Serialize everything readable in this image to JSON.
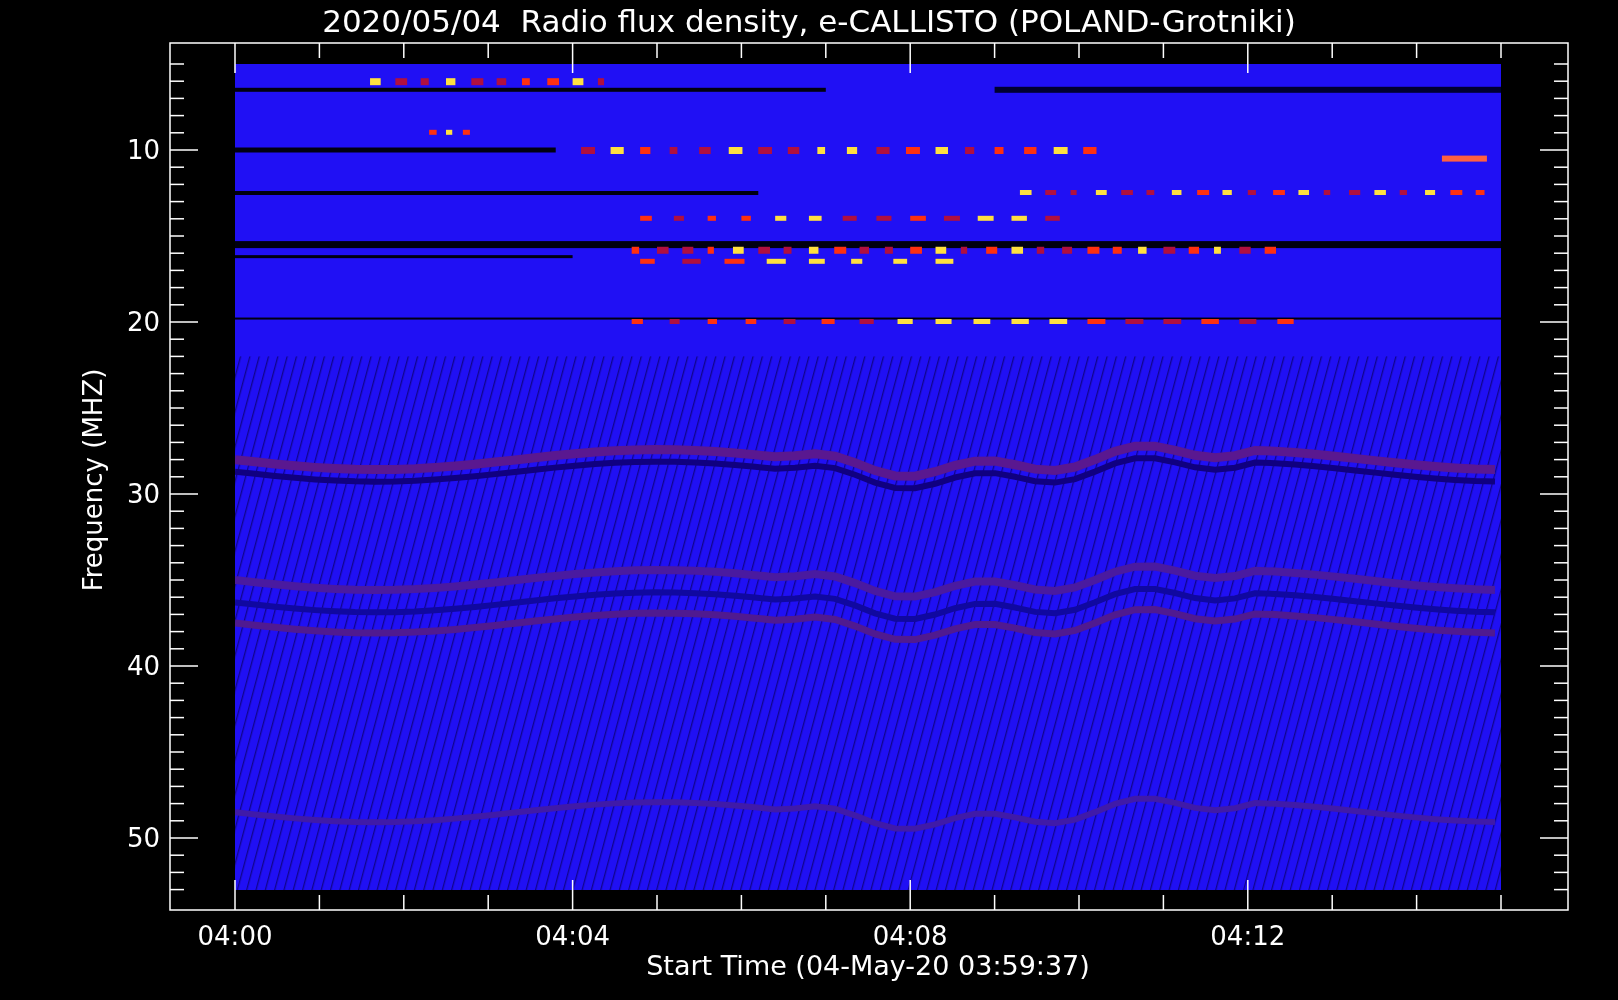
{
  "title": "2020/05/04  Radio flux density, e-CALLISTO (POLAND-Grotniki)",
  "y_axis": {
    "label": "Frequency (MHZ)",
    "ticks": [
      "10",
      "20",
      "30",
      "40",
      "50"
    ]
  },
  "x_axis": {
    "label": "Start Time (04-May-20 03:59:37)",
    "ticks": [
      "04:00",
      "04:04",
      "04:08",
      "04:12"
    ]
  }
}
